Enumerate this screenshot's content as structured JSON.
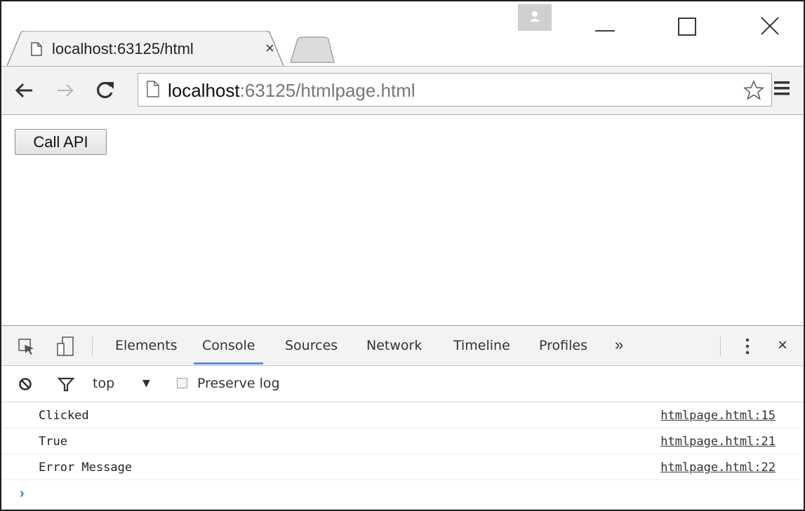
{
  "browser": {
    "tab": {
      "title": "localhost:63125/html",
      "close_glyph": "×"
    },
    "window_controls": [
      "minimize-icon",
      "maximize-icon",
      "close-icon"
    ],
    "toolbar": {
      "icons": [
        "back-arrow-icon",
        "forward-arrow-icon",
        "reload-icon",
        "star-icon",
        "menu-icon"
      ],
      "url_host": "localhost",
      "url_path": ":63125/htmlpage.html"
    }
  },
  "page": {
    "call_button_label": "Call API"
  },
  "devtools": {
    "tabs": [
      "Elements",
      "Console",
      "Sources",
      "Network",
      "Timeline",
      "Profiles"
    ],
    "active_tab": "Console",
    "more_glyph": "»",
    "close_glyph": "×",
    "console_toolbar": {
      "context": "top",
      "context_arrow": "▼",
      "preserve_log_label": "Preserve log"
    },
    "log_entries": [
      {
        "message": "Clicked",
        "source": "htmlpage.html:15"
      },
      {
        "message": "True",
        "source": "htmlpage.html:21"
      },
      {
        "message": "Error Message",
        "source": "htmlpage.html:22"
      }
    ],
    "prompt_glyph": "›",
    "accent_color": "#5c8de8",
    "prompt_color": "#2f7ef0"
  }
}
